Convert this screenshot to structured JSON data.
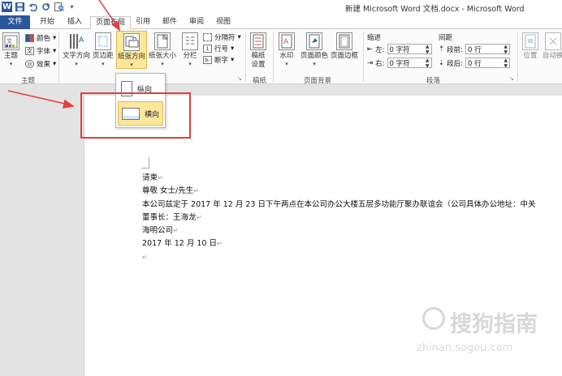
{
  "window": {
    "title": "新建 Microsoft Word 文档.docx - Microsoft Word",
    "qat_logo": "W",
    "qat_icons": [
      "save-icon",
      "undo-icon",
      "redo-icon",
      "print-preview-icon",
      "customize-qat-icon"
    ]
  },
  "tabs": [
    "文件",
    "开始",
    "插入",
    "页面布局",
    "引用",
    "邮件",
    "审阅",
    "视图"
  ],
  "active_tab": "页面布局",
  "ribbon": {
    "themes": {
      "main_label": "主题",
      "colors": "颜色",
      "fonts": "字体",
      "effects": "效果",
      "group_label": "主题"
    },
    "page_setup": {
      "text_direction": "文字方向",
      "margins": "页边距",
      "orientation": "纸张方向",
      "size": "纸张大小",
      "columns": "分栏",
      "breaks": "分隔符",
      "line_numbers": "行号",
      "hyphenation": "断字"
    },
    "draft": {
      "label_line1": "稿纸",
      "label_line2": "设置",
      "group_label": "稿纸"
    },
    "page_background": {
      "watermark": "水印",
      "page_color": "页面颜色",
      "page_borders": "页面边框",
      "group_label": "页面背景"
    },
    "paragraph": {
      "indent_label": "缩进",
      "spacing_label": "间距",
      "left_label": "左:",
      "left_value": "0 字符",
      "right_label": "右:",
      "right_value": "0 字符",
      "before_label": "段前:",
      "before_value": "0 行",
      "after_label": "段后:",
      "after_value": "0 行",
      "group_label": "段落"
    },
    "arrange": {
      "position": "位置",
      "wrap": "自动换"
    }
  },
  "orientation_menu": {
    "portrait": "纵向",
    "landscape": "横向"
  },
  "document": {
    "lines": [
      "请柬",
      "尊敬      女士/先生",
      "本公司兹定于 2017 年 12 月 23 日下午两点在本公司办公大楼五层多功能厅聚办联谊会（公司具体办公地址：中关",
      "董事长：王海龙",
      "海明公司",
      "2017 年 12 月 10 日"
    ]
  },
  "watermark": {
    "main": "搜狗指南",
    "sub": "zhinan.sogou.com"
  },
  "colors": {
    "file_tab": "#2b579a",
    "highlight": "#fce79c",
    "annotation_red": "#e04040"
  }
}
